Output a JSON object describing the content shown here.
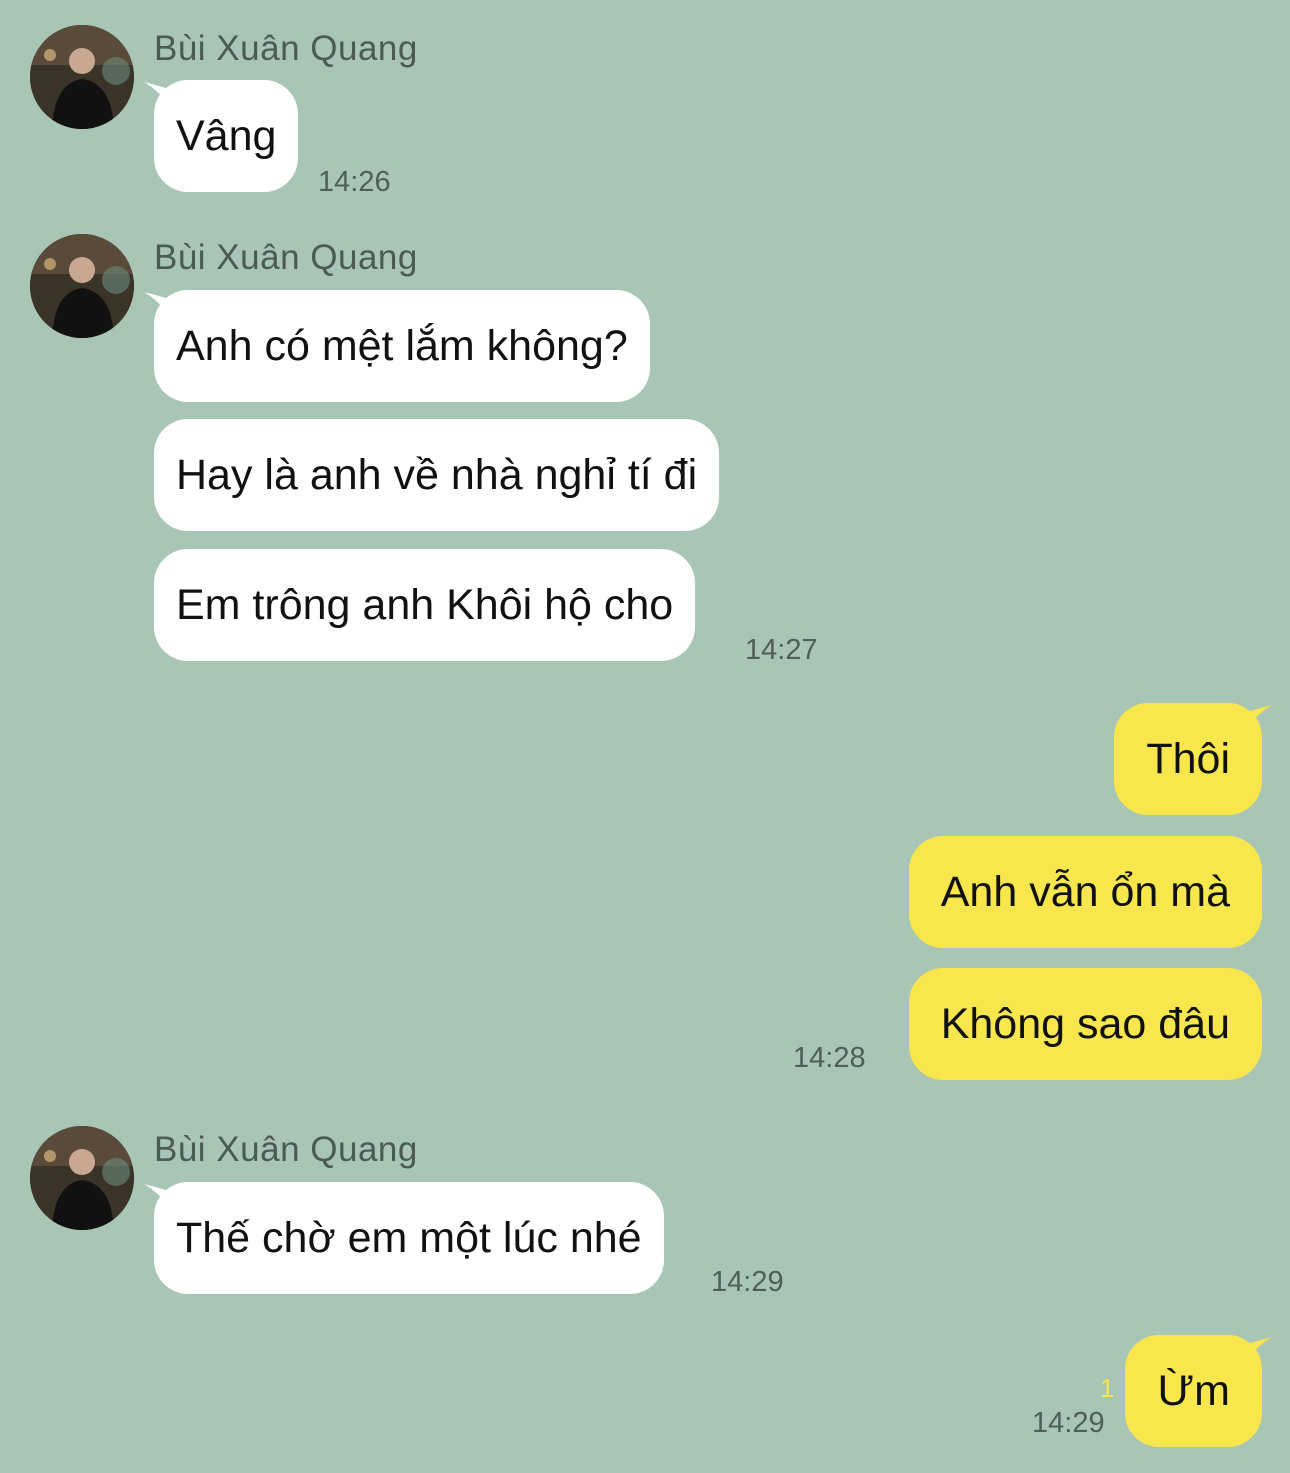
{
  "contact": {
    "name": "Bùi Xuân Quang",
    "avatar_icon": "profile-photo-icon"
  },
  "colors": {
    "background": "#a8c5b6",
    "incoming_bubble": "#ffffff",
    "outgoing_bubble": "#f8e64d",
    "timestamp": "#4f5f57",
    "unread_count": "#f5e84a"
  },
  "groups": [
    {
      "direction": "in",
      "sender": "Bùi Xuân Quang",
      "messages": [
        "Vâng"
      ],
      "time": "14:26"
    },
    {
      "direction": "in",
      "sender": "Bùi Xuân Quang",
      "messages": [
        "Anh có mệt lắm không?",
        "Hay là anh về nhà nghỉ tí đi",
        "Em trông anh Khôi hộ cho"
      ],
      "time": "14:27"
    },
    {
      "direction": "out",
      "messages": [
        "Thôi",
        "Anh vẫn ổn mà",
        "Không sao đâu"
      ],
      "time": "14:28"
    },
    {
      "direction": "in",
      "sender": "Bùi Xuân Quang",
      "messages": [
        "Thế chờ em một lúc nhé"
      ],
      "time": "14:29"
    },
    {
      "direction": "out",
      "messages": [
        "Ừm"
      ],
      "time": "14:29",
      "unread": "1"
    }
  ]
}
